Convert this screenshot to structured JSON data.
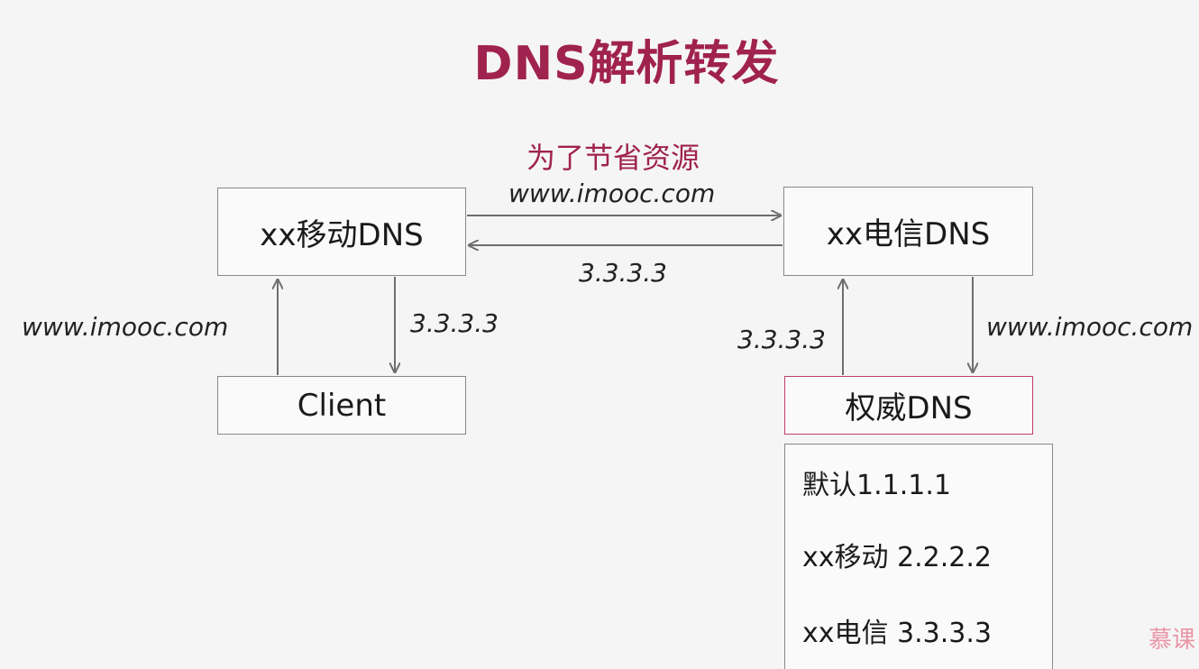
{
  "title": "DNS解析转发",
  "note": "为了节省资源",
  "boxes": {
    "mobile_dns": "xx移动DNS",
    "telecom_dns": "xx电信DNS",
    "client": "Client",
    "authoritative_dns": "权威DNS"
  },
  "edges": {
    "mobile_to_telecom": "www.imooc.com",
    "telecom_to_mobile": "3.3.3.3",
    "client_to_mobile": "www.imooc.com",
    "mobile_to_client": "3.3.3.3",
    "auth_to_telecom": "3.3.3.3",
    "telecom_to_auth": "www.imooc.com"
  },
  "records": [
    "默认1.1.1.1",
    "xx移动 2.2.2.2",
    "xx电信 3.3.3.3"
  ],
  "watermark": "慕课",
  "colors": {
    "title": "#a0224e",
    "note": "#a0224e",
    "arrow": "#6e6e6e",
    "authoritative_border": "#c0406e"
  }
}
